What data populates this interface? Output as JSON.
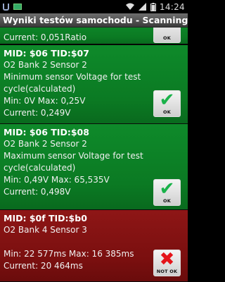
{
  "status_bar": {
    "time": "14:24",
    "left_icons": [
      "usb-icon",
      "gallery-icon"
    ],
    "right_icons": [
      "wifi-icon",
      "signal-icon",
      "battery-icon"
    ]
  },
  "title": "Wyniki testów samochodu - Scanning(%...",
  "partial_top": {
    "text": "Current: 0,051Ratio",
    "badge": "OK"
  },
  "items": [
    {
      "mid": "MID: $06 TID:$07",
      "sensor": "O2 Bank 2 Sensor 2",
      "desc1": "Minimum sensor Voltage for test",
      "desc2": "cycle(calculated)",
      "minmax": "Min: 0V  Max: 0,25V",
      "current": "Current: 0,249V",
      "status": "pass",
      "badge": "OK"
    },
    {
      "mid": "MID: $06 TID:$08",
      "sensor": "O2 Bank 2 Sensor 2",
      "desc1": "Maximum sensor Voltage for test",
      "desc2": "cycle(calculated)",
      "minmax": "Min: 0,49V  Max: 65,535V",
      "current": "Current: 0,498V",
      "status": "pass",
      "badge": "OK"
    },
    {
      "mid": "MID: $0f TID:$b0",
      "sensor": "O2 Bank 4 Sensor 3",
      "desc1": "",
      "desc2": "",
      "minmax": "Min: 22 577ms  Max: 16 385ms",
      "current": "Current: 20 464ms",
      "status": "fail",
      "badge": "NOT OK"
    }
  ],
  "colors": {
    "pass_bg": "#0b7a23",
    "fail_bg": "#7a0f0f",
    "ok_mark": "#1ab24a",
    "bad_mark": "#e4141a"
  }
}
